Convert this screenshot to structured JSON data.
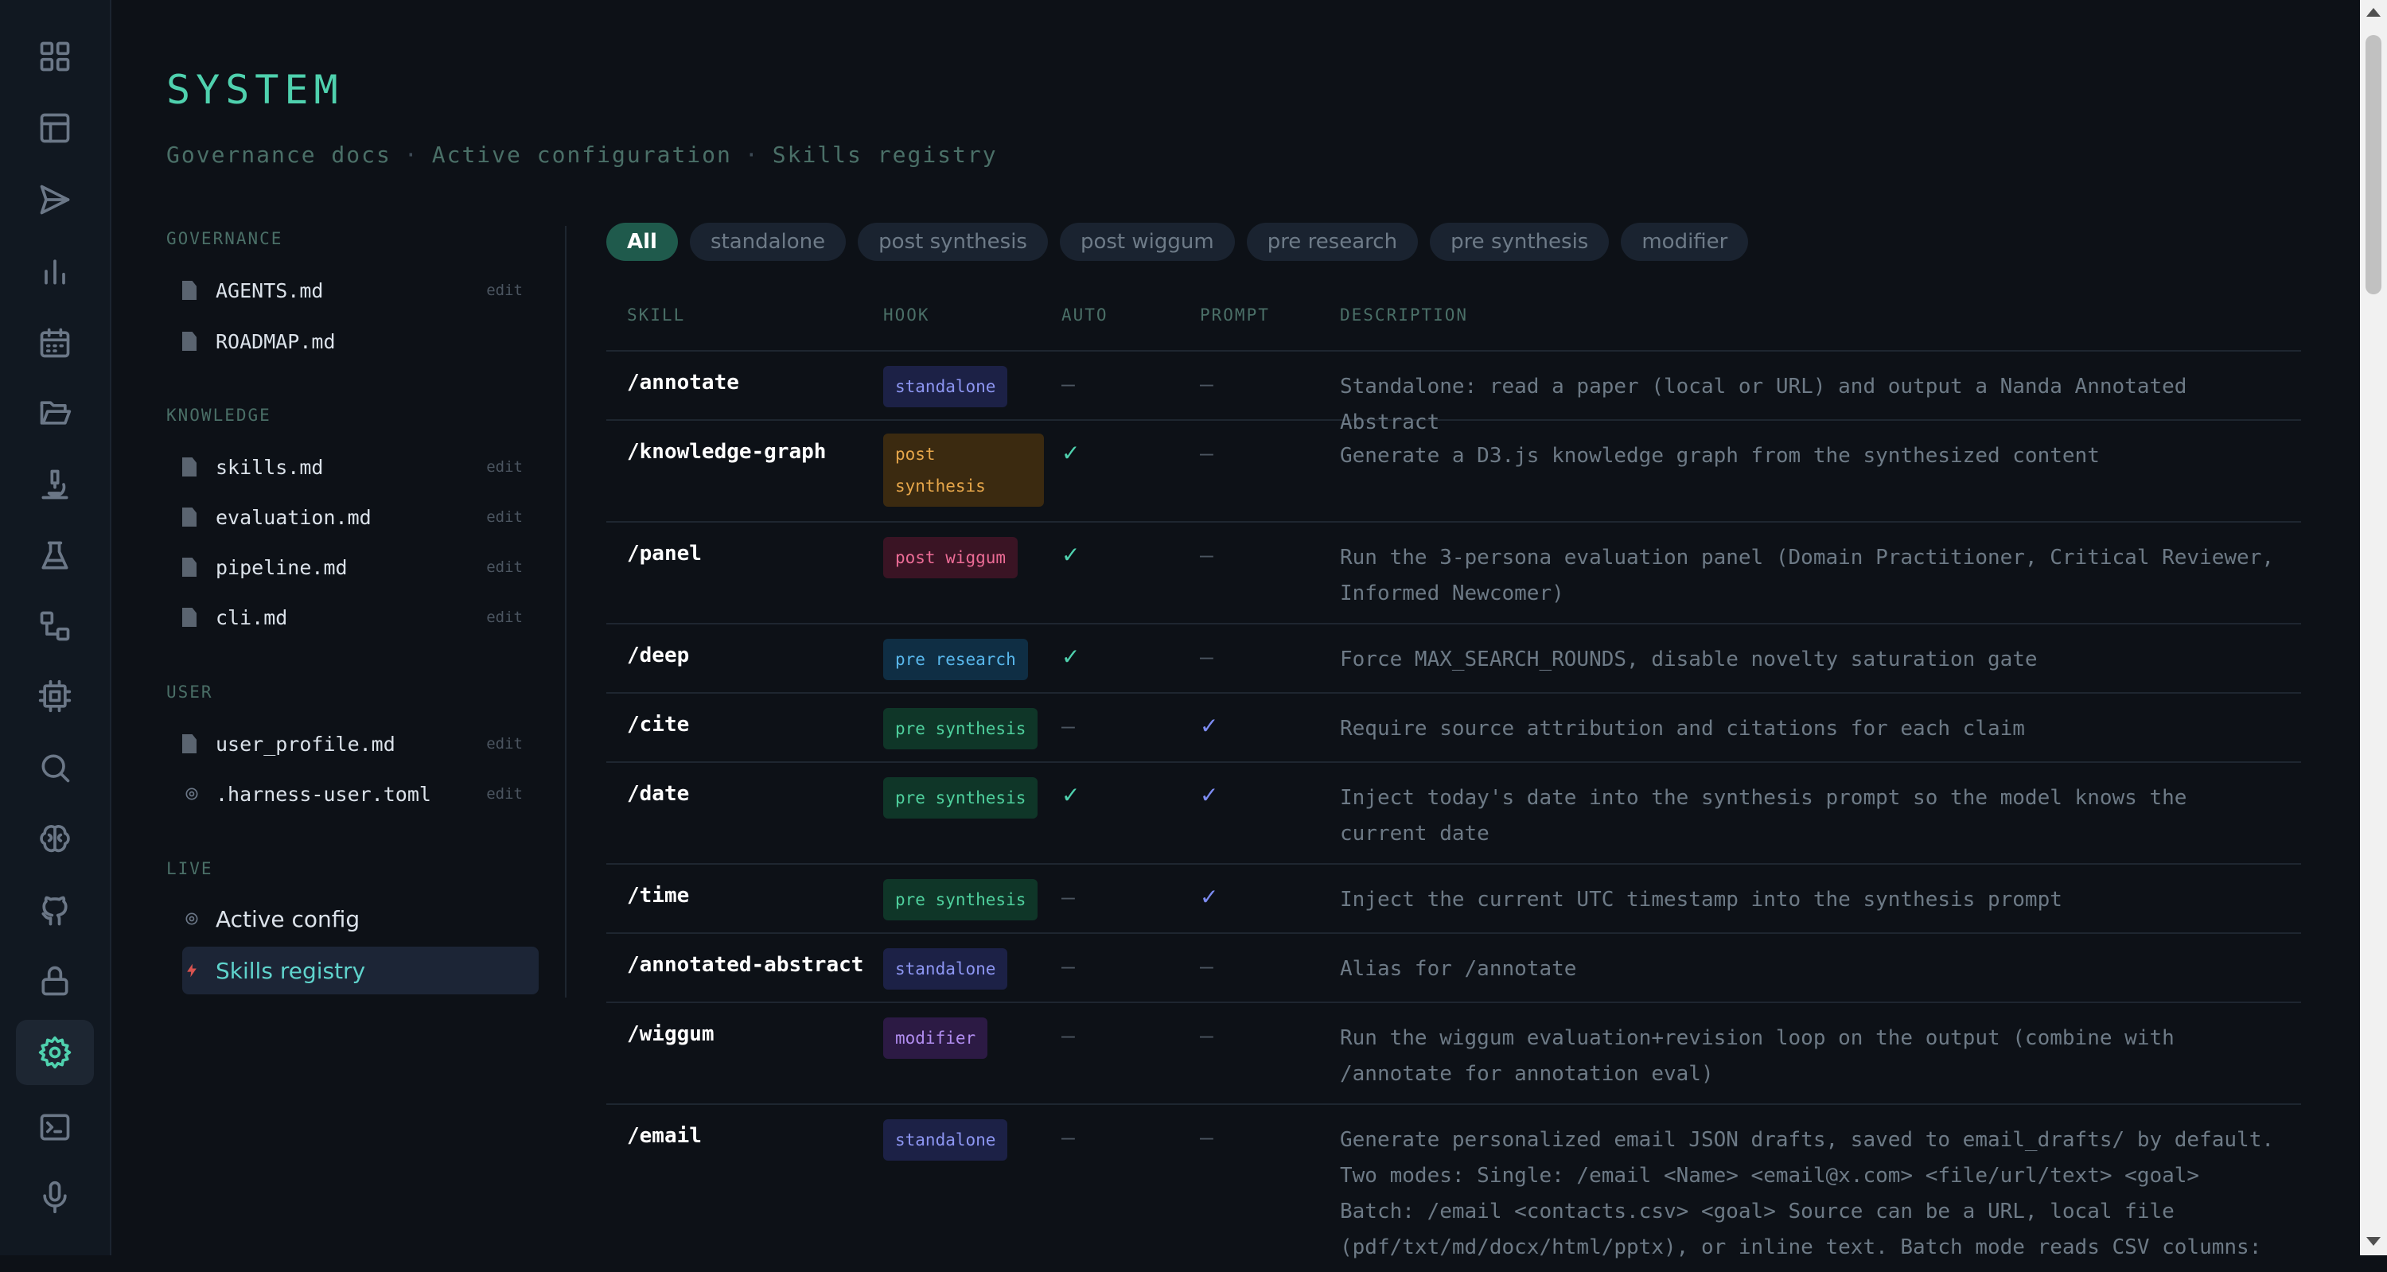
{
  "rail": {
    "items": [
      {
        "name": "dashboard-icon"
      },
      {
        "name": "table-icon"
      },
      {
        "name": "send-icon"
      },
      {
        "name": "bar-chart-icon"
      },
      {
        "name": "calendar-icon"
      },
      {
        "name": "folder-icon"
      },
      {
        "name": "microscope-icon"
      },
      {
        "name": "flask-icon"
      },
      {
        "name": "workflow-icon"
      },
      {
        "name": "chip-icon"
      },
      {
        "name": "search-icon"
      },
      {
        "name": "brain-icon"
      },
      {
        "name": "github-icon"
      },
      {
        "name": "lock-icon"
      },
      {
        "name": "gear-icon",
        "active": true
      },
      {
        "name": "terminal-icon"
      },
      {
        "name": "microphone-icon"
      }
    ]
  },
  "header": {
    "title": "SYSTEM",
    "breadcrumb": [
      "Governance docs",
      "Active configuration",
      "Skills registry"
    ],
    "separator": "·"
  },
  "docs": {
    "governance": {
      "label": "GOVERNANCE",
      "items": [
        {
          "name": "AGENTS.md",
          "edit": "edit"
        },
        {
          "name": "ROADMAP.md"
        }
      ]
    },
    "knowledge": {
      "label": "KNOWLEDGE",
      "items": [
        {
          "name": "skills.md",
          "edit": "edit"
        },
        {
          "name": "evaluation.md",
          "edit": "edit"
        },
        {
          "name": "pipeline.md",
          "edit": "edit"
        },
        {
          "name": "cli.md",
          "edit": "edit"
        }
      ]
    },
    "user": {
      "label": "USER",
      "items": [
        {
          "name": "user_profile.md",
          "edit": "edit"
        },
        {
          "name": ".harness-user.toml",
          "edit": "edit"
        }
      ]
    },
    "live": {
      "label": "LIVE",
      "items": [
        {
          "name": "Active config"
        },
        {
          "name": "Skills registry",
          "active": true
        }
      ]
    }
  },
  "filters": [
    "All",
    "standalone",
    "post synthesis",
    "post wiggum",
    "pre research",
    "pre synthesis",
    "modifier"
  ],
  "filter_active": "All",
  "table": {
    "headers": {
      "skill": "SKILL",
      "hook": "HOOK",
      "auto": "AUTO",
      "prompt": "PROMPT",
      "description": "DESCRIPTION"
    },
    "rows": [
      {
        "skill": "/annotate",
        "hook": "standalone",
        "auto": "—",
        "prompt": "—",
        "description": "Standalone: read a paper (local or URL) and output a Nanda Annotated Abstract"
      },
      {
        "skill": "/knowledge-graph",
        "hook": "post synthesis",
        "auto": "✓",
        "prompt": "—",
        "description": "Generate a D3.js knowledge graph from the synthesized content"
      },
      {
        "skill": "/panel",
        "hook": "post wiggum",
        "auto": "✓",
        "prompt": "—",
        "description": "Run the 3-persona evaluation panel (Domain Practitioner, Critical Reviewer, Informed Newcomer)"
      },
      {
        "skill": "/deep",
        "hook": "pre research",
        "auto": "✓",
        "prompt": "—",
        "description": "Force MAX_SEARCH_ROUNDS, disable novelty saturation gate"
      },
      {
        "skill": "/cite",
        "hook": "pre synthesis",
        "auto": "—",
        "prompt": "✓",
        "description": "Require source attribution and citations for each claim"
      },
      {
        "skill": "/date",
        "hook": "pre synthesis",
        "auto": "✓",
        "prompt": "✓",
        "description": "Inject today's date into the synthesis prompt so the model knows the current date"
      },
      {
        "skill": "/time",
        "hook": "pre synthesis",
        "auto": "—",
        "prompt": "✓",
        "description": "Inject the current UTC timestamp into the synthesis prompt"
      },
      {
        "skill": "/annotated-abstract",
        "hook": "standalone",
        "auto": "—",
        "prompt": "—",
        "description": "Alias for /annotate"
      },
      {
        "skill": "/wiggum",
        "hook": "modifier",
        "auto": "—",
        "prompt": "—",
        "description": "Run the wiggum evaluation+revision loop on the output (combine with /annotate for annotation eval)"
      },
      {
        "skill": "/email",
        "hook": "standalone",
        "auto": "—",
        "prompt": "—",
        "description": "Generate personalized email JSON drafts, saved to email_drafts/ by default. Two modes: Single: /email <Name> <email@x.com> <file/url/text> <goal> Batch: /email <contacts.csv> <goal> Source can be a URL, local file (pdf/txt/md/docx/html/pptx), or inline text. Batch mode reads CSV columns:"
      }
    ]
  }
}
